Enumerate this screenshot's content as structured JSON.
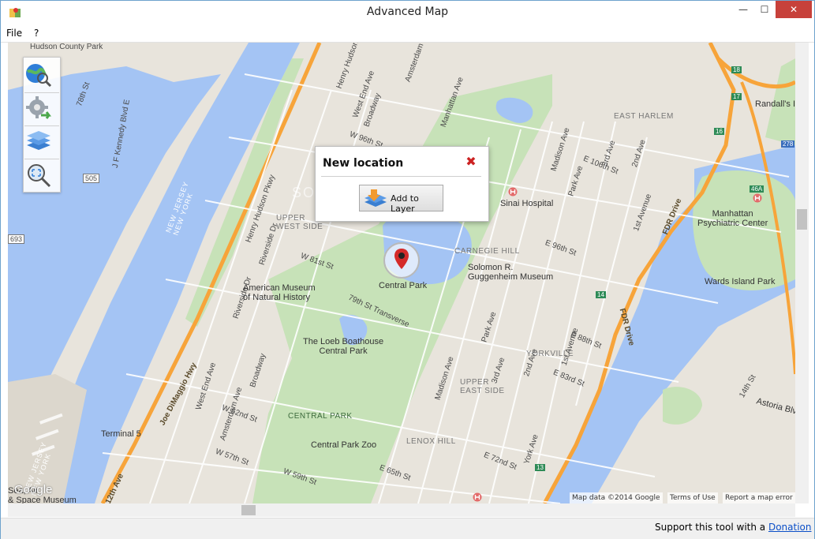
{
  "window": {
    "title": "Advanced Map"
  },
  "menu": {
    "items": [
      "File",
      "?"
    ]
  },
  "popup": {
    "title": "New location",
    "button_label": "Add to Layer"
  },
  "toolbar": {
    "tools": [
      "globe-search-icon",
      "settings-export-icon",
      "layers-icon",
      "zoom-fit-icon"
    ]
  },
  "map": {
    "labels": {
      "hudson_county_park": "Hudson County Park",
      "henry_hudson_pkwy": "Henry Hudson Pkwy",
      "henry_hudson_pkwy_2": "Henry Hudson Pkwy",
      "jf_kennedy": "J F Kennedy Blvd E",
      "w78": "78th St",
      "route505": "505",
      "route693": "693",
      "new_jersey_new_york_1": "NEW JERSEY\nNEW YORK",
      "new_jersey_new_york_2": "NEW JERSEY\nNEW YORK",
      "west_end_ave_top": "West End Ave",
      "broadway_top": "Broadway",
      "amsterdam_top": "Amsterdam",
      "manhattan_ave": "Manhattan Ave",
      "w96": "W 96th St",
      "upper_west_side": "UPPER\nWEST SIDE",
      "riverside_dr": "Riverside Dr",
      "riverside_dr_2": "Riverside Dr",
      "w81": "W 81st St",
      "amnh": "American Museum\nof Natural History",
      "central_park": "Central Park",
      "transverse": "79th St Transverse",
      "loeb": "The Loeb Boathouse\nCentral Park",
      "joe_dimaggio": "Joe DiMaggio Hwy",
      "west_end_ave": "West End Ave",
      "amsterdam_ave": "Amsterdam Ave",
      "broadway": "Broadway",
      "w62": "W 62nd St",
      "terminal5": "Terminal 5",
      "twelfth_ave": "12th Ave",
      "w57": "W 57th St",
      "w59": "W 59th St",
      "central_park_area": "CENTRAL PARK",
      "central_park_zoo": "Central Park Zoo",
      "intrepid": "Sea, Air\n& Space Museum",
      "lenox_hill": "LENOX HILL",
      "e65": "E 65th St",
      "upper_east_side": "UPPER\nEAST SIDE",
      "carnegie_hill": "CARNEGIE HILL",
      "guggenheim": "Solomon R.\nGuggenheim Museum",
      "sinai": "Sinai Hospital",
      "e96": "E 96th St",
      "madison_ave_top": "Madison Ave",
      "park_ave_top": "Park Ave",
      "third_ave_top": "3rd Ave",
      "second_ave_top": "2nd Ave",
      "e106": "E 106th St",
      "east_harlem": "EAST HARLEM",
      "first_ave": "1st Avenue",
      "fdr_drive_1": "FDR Drive",
      "fdr_drive_2": "FDR Drive",
      "madison_ave": "Madison Ave",
      "park_ave": "Park Ave",
      "third_ave": "3rd Ave",
      "second_ave": "2nd Ave",
      "first_ave_2": "1st Avenue",
      "e88": "E 88th St",
      "e83": "E 83rd St",
      "yorkville": "YORKVILLE",
      "york_ave": "York Ave",
      "e72": "E 72nd St",
      "e14": "14th St",
      "astoria": "Astoria Blv",
      "manhattan_psych": "Manhattan\nPsychiatric Center",
      "wards_island": "Wards Island Park",
      "randalls": "Randall's I",
      "route278": "278",
      "e46a": "46A",
      "e16": "16",
      "e17": "17",
      "e18": "18",
      "e14_route": "14",
      "e13": "13"
    },
    "attribution": {
      "google": "Google",
      "mapdata": "Map data ©2014 Google",
      "terms": "Terms of Use",
      "report": "Report a map error"
    },
    "watermark": "SOFTPEDIA"
  },
  "status": {
    "text": "Support this tool with a",
    "link": "Donation"
  },
  "colors": {
    "water": "#a4c4f4",
    "park": "#c7e2b8",
    "land": "#e8e4dc",
    "highway": "#f7a43a",
    "close": "#c7413b"
  }
}
